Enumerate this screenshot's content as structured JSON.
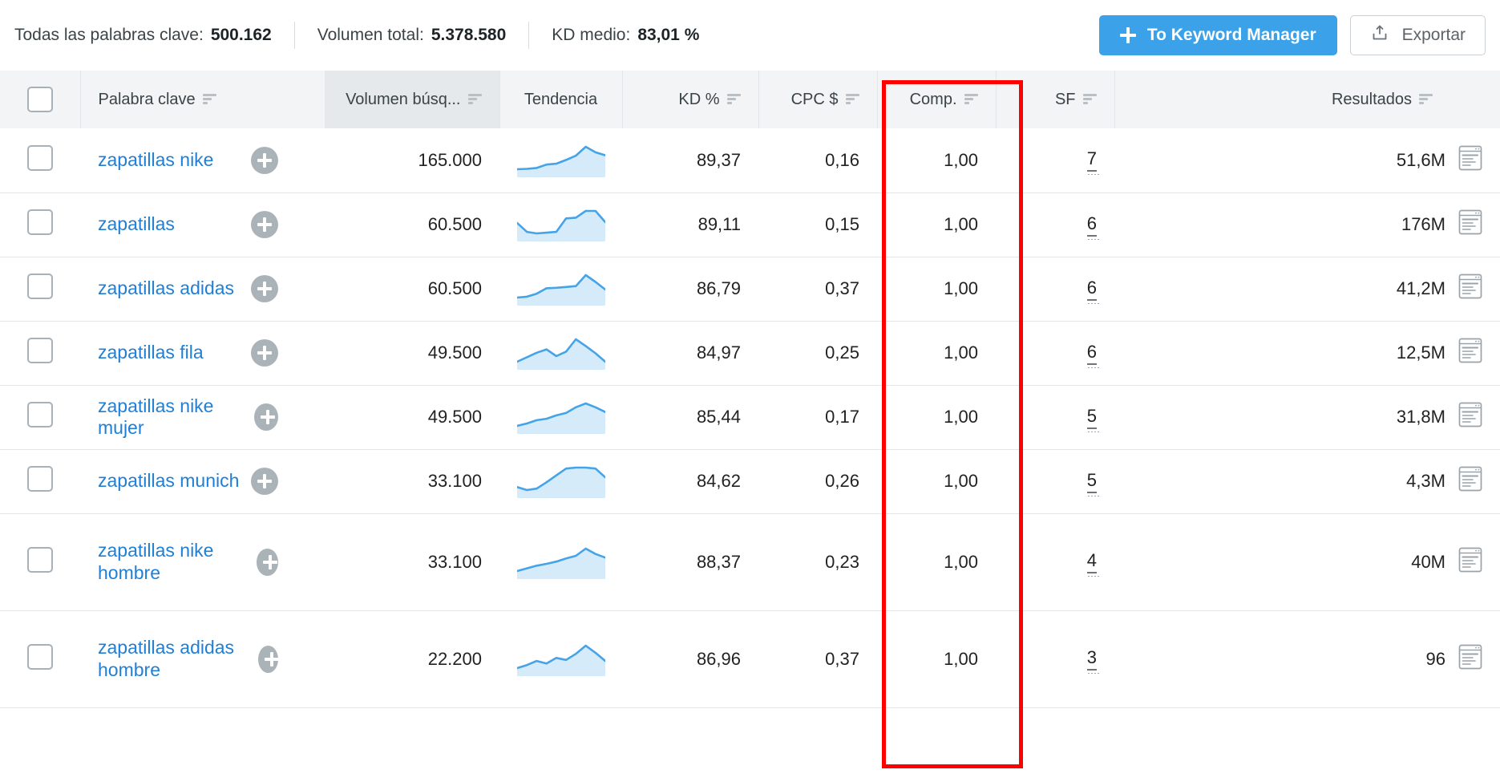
{
  "topbar": {
    "summary": [
      {
        "label": "Todas las palabras clave:",
        "value": "500.162"
      },
      {
        "label": "Volumen total:",
        "value": "5.378.580"
      },
      {
        "label": "KD medio:",
        "value": "83,01 %"
      }
    ],
    "primary_button": {
      "label": "To Keyword Manager",
      "icon": "plus-icon",
      "color": "#3ba1e8"
    },
    "secondary_button": {
      "label": "Exportar",
      "icon": "export-upload-icon"
    }
  },
  "table": {
    "columns": [
      {
        "key": "select",
        "label": "",
        "align": "center",
        "sortable": false,
        "shaded": false
      },
      {
        "key": "keyword",
        "label": "Palabra clave",
        "align": "left",
        "sortable": true,
        "shaded": false
      },
      {
        "key": "volume",
        "label": "Volumen búsq...",
        "align": "right",
        "sortable": true,
        "shaded": true
      },
      {
        "key": "trend",
        "label": "Tendencia",
        "align": "center",
        "sortable": false,
        "shaded": false
      },
      {
        "key": "kd",
        "label": "KD %",
        "align": "right",
        "sortable": true,
        "shaded": false
      },
      {
        "key": "cpc",
        "label": "CPC $",
        "align": "right",
        "sortable": true,
        "shaded": false
      },
      {
        "key": "comp",
        "label": "Comp.",
        "align": "right",
        "sortable": true,
        "shaded": false
      },
      {
        "key": "sf",
        "label": "SF",
        "align": "right",
        "sortable": true,
        "shaded": false
      },
      {
        "key": "results",
        "label": "Resultados",
        "align": "right",
        "sortable": true,
        "shaded": false
      }
    ],
    "rows": [
      {
        "keyword": "zapatillas nike",
        "volume": "165.000",
        "kd": "89,37",
        "cpc": "0,16",
        "comp": "1,00",
        "sf": "7",
        "results": "51,6M",
        "trend": [
          30,
          31,
          33,
          41,
          43,
          52,
          62,
          83,
          70,
          63
        ],
        "multiline": false
      },
      {
        "keyword": "zapatillas",
        "volume": "60.500",
        "kd": "89,11",
        "cpc": "0,15",
        "comp": "1,00",
        "sf": "6",
        "results": "176M",
        "trend": [
          54,
          42,
          40,
          41,
          42,
          60,
          61,
          70,
          70,
          55
        ],
        "multiline": false
      },
      {
        "keyword": "zapatillas adidas",
        "volume": "60.500",
        "kd": "86,79",
        "cpc": "0,37",
        "comp": "1,00",
        "sf": "6",
        "results": "41,2M",
        "trend": [
          33,
          35,
          42,
          55,
          56,
          58,
          60,
          86,
          70,
          52
        ],
        "multiline": false
      },
      {
        "keyword": "zapatillas fila",
        "volume": "49.500",
        "kd": "84,97",
        "cpc": "0,25",
        "comp": "1,00",
        "sf": "6",
        "results": "12,5M",
        "trend": [
          40,
          48,
          56,
          62,
          50,
          58,
          80,
          68,
          55,
          40
        ],
        "multiline": false
      },
      {
        "keyword": "zapatillas nike mujer",
        "volume": "49.500",
        "kd": "85,44",
        "cpc": "0,17",
        "comp": "1,00",
        "sf": "5",
        "results": "31,8M",
        "trend": [
          33,
          38,
          45,
          48,
          55,
          60,
          72,
          80,
          72,
          62
        ],
        "multiline": false
      },
      {
        "keyword": "zapatillas munich",
        "volume": "33.100",
        "kd": "84,62",
        "cpc": "0,26",
        "comp": "1,00",
        "sf": "5",
        "results": "4,3M",
        "trend": [
          38,
          32,
          35,
          48,
          62,
          76,
          78,
          78,
          76,
          58
        ],
        "multiline": false
      },
      {
        "keyword": "zapatillas nike hombre",
        "volume": "33.100",
        "kd": "88,37",
        "cpc": "0,23",
        "comp": "1,00",
        "sf": "4",
        "results": "40M",
        "trend": [
          32,
          38,
          44,
          48,
          53,
          60,
          66,
          82,
          70,
          62
        ],
        "multiline": true
      },
      {
        "keyword": "zapatillas adidas hombre",
        "volume": "22.200",
        "kd": "86,96",
        "cpc": "0,37",
        "comp": "1,00",
        "sf": "3",
        "results": "96",
        "trend": [
          36,
          42,
          50,
          45,
          56,
          52,
          64,
          80,
          66,
          50
        ],
        "multiline": true
      }
    ]
  },
  "annotation": {
    "type": "red-rectangle-highlight",
    "target_column": "CPC $",
    "color": "#ff0000"
  },
  "icons": {
    "sort": "sort-icon",
    "add": "add-to-list-icon",
    "serp": "serp-preview-icon",
    "checkbox": "checkbox-icon"
  }
}
